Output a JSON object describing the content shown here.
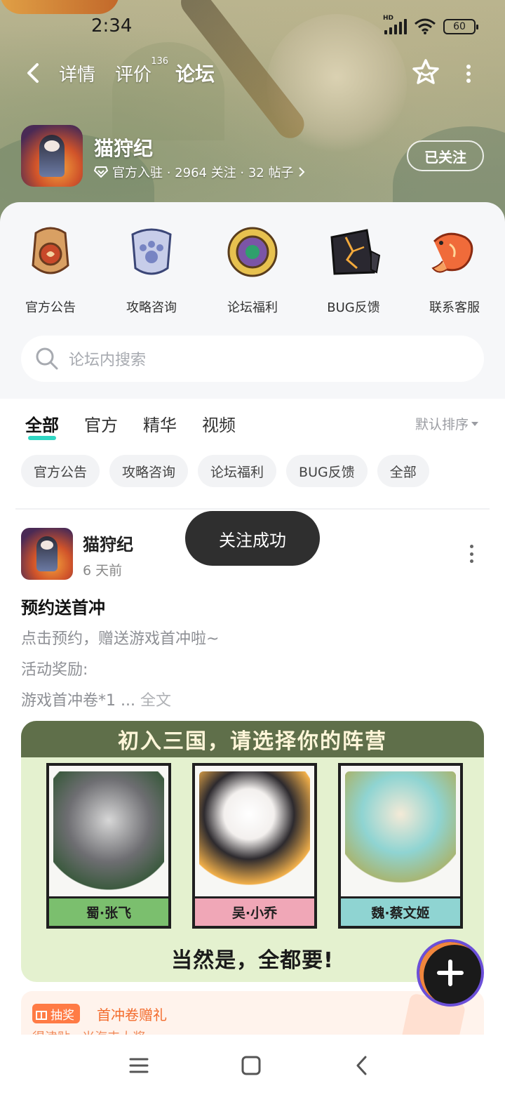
{
  "status_bar": {
    "time": "2:34",
    "network": "HD",
    "battery": "60"
  },
  "nav": {
    "tabs": [
      {
        "label": "详情"
      },
      {
        "label": "评价",
        "badge": "136"
      },
      {
        "label": "论坛"
      }
    ],
    "active_tab": "论坛"
  },
  "game": {
    "name": "猫狩纪",
    "meta": "官方入驻 · 2964 关注 · 32 帖子",
    "follow_label": "已关注"
  },
  "categories": [
    {
      "label": "官方公告",
      "icon": "scroll-seal-icon"
    },
    {
      "label": "攻略咨询",
      "icon": "paw-shield-icon"
    },
    {
      "label": "论坛福利",
      "icon": "jade-medal-icon"
    },
    {
      "label": "BUG反馈",
      "icon": "cracked-stone-icon"
    },
    {
      "label": "联系客服",
      "icon": "koi-fish-icon"
    }
  ],
  "search": {
    "placeholder": "论坛内搜索"
  },
  "main_tabs": [
    {
      "label": "全部"
    },
    {
      "label": "官方"
    },
    {
      "label": "精华"
    },
    {
      "label": "视频"
    }
  ],
  "sort": {
    "label": "默认排序"
  },
  "chips": [
    {
      "label": "官方公告"
    },
    {
      "label": "攻略咨询"
    },
    {
      "label": "论坛福利"
    },
    {
      "label": "BUG反馈"
    },
    {
      "label": "全部"
    }
  ],
  "post": {
    "author": "猫狩纪",
    "time": "6 天前",
    "title": "预约送首冲",
    "lines": [
      "点击预约，赠送游戏首冲啦~",
      "活动奖励:",
      "游戏首冲卷*1"
    ],
    "ellipsis": "...",
    "full_text": "全文",
    "image": {
      "title": "初入三国，请选择你的阵营",
      "cards": [
        {
          "caption": "蜀·张飞",
          "color": "#7bbf6e"
        },
        {
          "caption": "吴·小乔",
          "color": "#f0a7b7"
        },
        {
          "caption": "魏·蔡文姬",
          "color": "#8fd4d2"
        }
      ],
      "footer": "当然是，全都要!"
    }
  },
  "lottery": {
    "tag": "抽奖",
    "title": "首冲卷赠礼",
    "subtitle": "得津贴 · 米海丰大奖"
  },
  "toast": {
    "text": "关注成功"
  },
  "colors": {
    "accent": "#2fd6c3",
    "toast_bg": "#2f2f2f",
    "lottery": "#ff7b45"
  }
}
